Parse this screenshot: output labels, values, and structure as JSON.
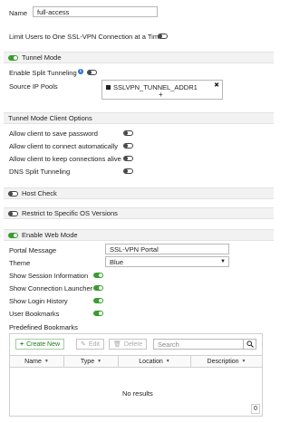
{
  "name": {
    "label": "Name",
    "value": "full-access"
  },
  "limit_users": {
    "label": "Limit Users to One SSL-VPN Connection at a Time",
    "on": false
  },
  "tunnel_mode": {
    "label": "Tunnel Mode",
    "on": true,
    "split_tunneling": {
      "label": "Enable Split Tunneling",
      "info_icon": "i",
      "on": false
    },
    "source_ip_pools": {
      "label": "Source IP Pools",
      "entry": "SSLVPN_TUNNEL_ADDR1",
      "remove": "✖",
      "add": "+"
    }
  },
  "client_options": {
    "header": "Tunnel Mode Client Options",
    "items": [
      {
        "label": "Allow client to save password",
        "on": false
      },
      {
        "label": "Allow client to connect automatically",
        "on": false
      },
      {
        "label": "Allow client to keep connections alive",
        "on": false
      },
      {
        "label": "DNS Split Tunneling",
        "on": false
      }
    ]
  },
  "host_check": {
    "label": "Host Check",
    "on": false
  },
  "restrict_os": {
    "label": "Restrict to Specific OS Versions",
    "on": false
  },
  "web_mode": {
    "label": "Enable Web Mode",
    "on": true,
    "portal_message": {
      "label": "Portal Message",
      "value": "SSL-VPN Portal"
    },
    "theme": {
      "label": "Theme",
      "value": "Blue"
    },
    "options": [
      {
        "label": "Show Session Information",
        "on": true
      },
      {
        "label": "Show Connection Launcher",
        "on": true
      },
      {
        "label": "Show Login History",
        "on": true
      },
      {
        "label": "User Bookmarks",
        "on": true
      }
    ]
  },
  "bookmarks": {
    "label": "Predefined Bookmarks",
    "create_new": "Create New",
    "edit": "Edit",
    "delete": "Delete",
    "search_placeholder": "Search",
    "columns": [
      "Name",
      "Type",
      "Location",
      "Description"
    ],
    "empty_text": "No results",
    "count": "0"
  }
}
